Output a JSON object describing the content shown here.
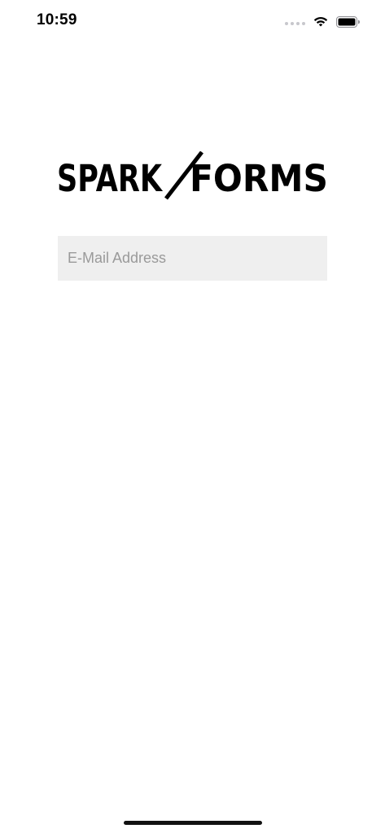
{
  "status_bar": {
    "time": "10:59",
    "signal_icon": "cellular-dots-icon",
    "wifi_icon": "wifi-icon",
    "battery_icon": "battery-icon"
  },
  "logo": {
    "text": "SPARKFORMS",
    "left_word": "SPARK",
    "right_word": "FORMS"
  },
  "login": {
    "email_placeholder": "E-Mail Address",
    "email_value": ""
  },
  "colors": {
    "background": "#ffffff",
    "field_background": "#efefef",
    "placeholder": "#9a9a9a",
    "logo": "#000000"
  }
}
